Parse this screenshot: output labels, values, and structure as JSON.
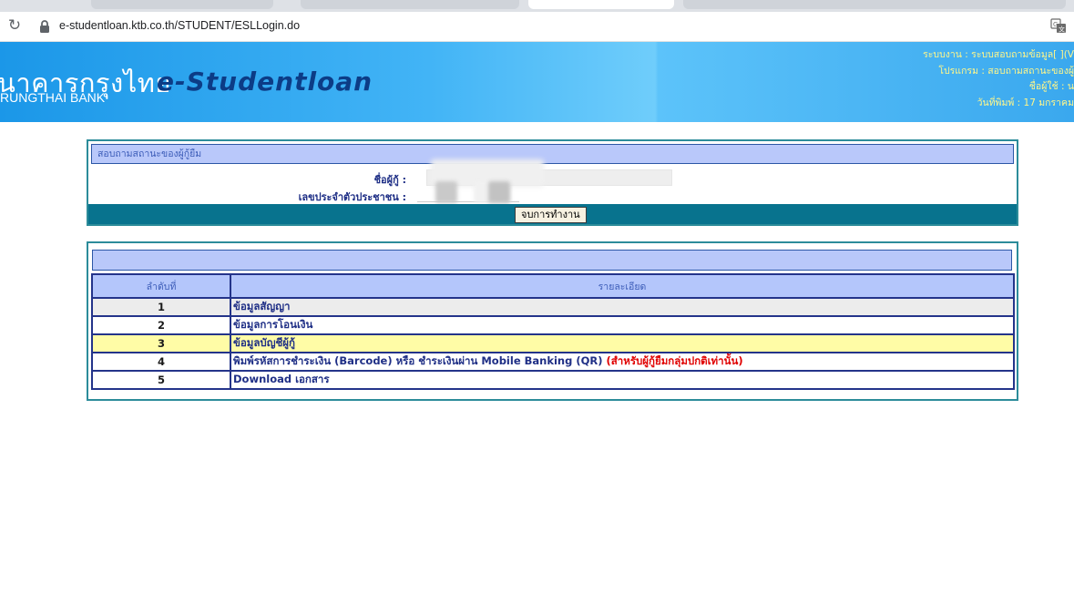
{
  "browser": {
    "url": "e-studentloan.ktb.co.th/STUDENT/ESLLogin.do",
    "icons": {
      "reload": "reload-icon",
      "lock": "lock-icon",
      "translate": "translate-icon"
    }
  },
  "header": {
    "bank_name_th": "นาคารกรุงไทย",
    "bank_name_en": "RUNGTHAI BANK",
    "app_name": "e-Studentloan",
    "system_line": "ระบบงาน : ระบบสอบถามข้อมูล[ ](V",
    "program_line": "โปรแกรม : สอบถามสถานะของผู้",
    "user_line": "ชื่อผู้ใช้ : น",
    "print_date_line": "วันที่พิมพ์ : 17 มกราคม",
    "text_color": "#fff68a"
  },
  "status_panel": {
    "title": "สอบถามสถานะของผู้กู้ยืม",
    "borrower_name_label": "ชื่อผู้กู้ :",
    "citizen_id_label": "เลขประจำตัวประชาชน :",
    "end_button": "จบการทำงาน"
  },
  "menu": {
    "headers": {
      "no": "ลำดับที่",
      "detail": "รายละเอียด"
    },
    "rows": [
      {
        "no": "1",
        "detail": "ข้อมูลสัญญา",
        "note": ""
      },
      {
        "no": "2",
        "detail": "ข้อมูลการโอนเงิน",
        "note": ""
      },
      {
        "no": "3",
        "detail": "ข้อมูลบัญชีผู้กู้",
        "note": ""
      },
      {
        "no": "4",
        "detail": "พิมพ์รหัสการชำระเงิน (Barcode) หรือ ชำระเงินผ่าน Mobile Banking (QR) ",
        "note": "(สำหรับผู้กู้ยืมกลุ่มปกติเท่านั้น)"
      },
      {
        "no": "5",
        "detail": "Download เอกสาร",
        "note": ""
      }
    ]
  },
  "colors": {
    "banner_blue": "#1b97e8",
    "app_name_navy": "#0c3c86",
    "panel_border_teal": "#2c8c9a",
    "header_lavender": "#b9c8fa",
    "row_highlight_yellow": "#fffca6",
    "note_red": "#e00000"
  }
}
